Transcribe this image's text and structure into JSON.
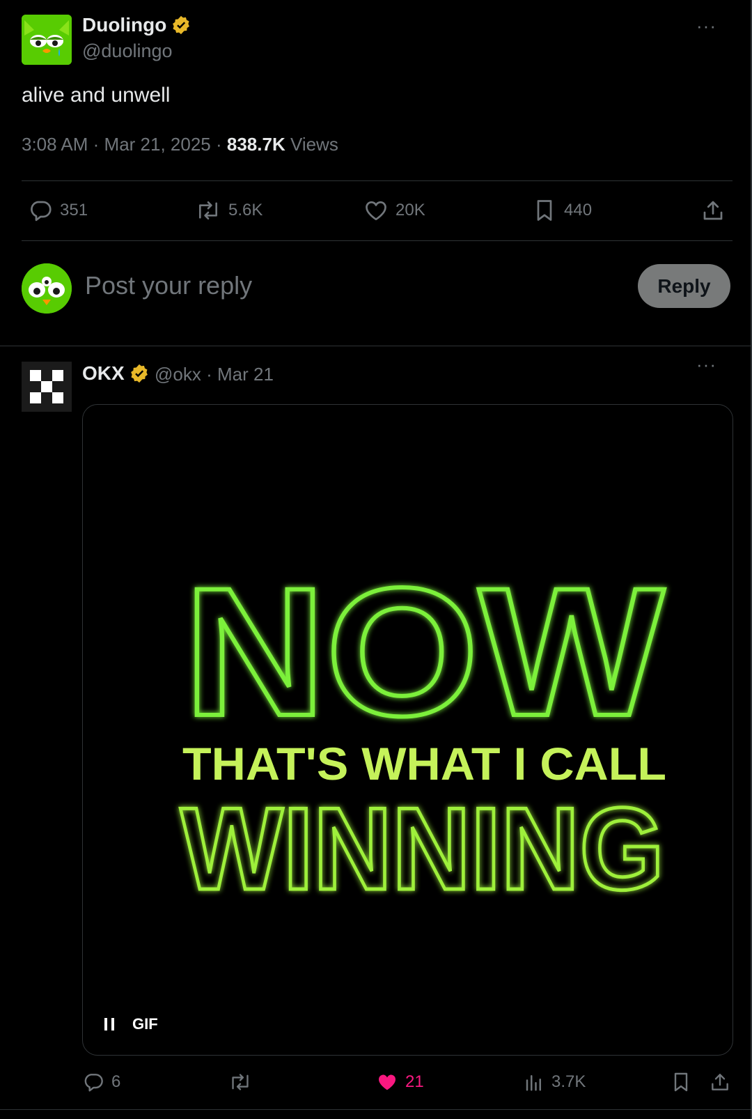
{
  "main_post": {
    "author_name": "Duolingo",
    "author_handle": "@duolingo",
    "text": "alive and unwell",
    "time": "3:08 AM",
    "date": "Mar 21, 2025",
    "views_count": "838.7K",
    "views_label": "Views",
    "stats": {
      "replies": "351",
      "reposts": "5.6K",
      "likes": "20K",
      "bookmarks": "440"
    },
    "more": "···"
  },
  "composer": {
    "placeholder": "Post your reply",
    "reply_button": "Reply"
  },
  "reply_post": {
    "author_name": "OKX",
    "author_handle": "@okx",
    "date": "Mar 21",
    "more": "···",
    "media": {
      "line1": "NOW",
      "line2": "THAT'S WHAT I CALL",
      "line3": "WINNING",
      "gif_label": "GIF"
    },
    "stats": {
      "replies": "6",
      "likes": "21",
      "views": "3.7K"
    }
  },
  "colors": {
    "accent_like": "#f91880",
    "verified": "#e8b829",
    "neon": "#7cf03a"
  }
}
